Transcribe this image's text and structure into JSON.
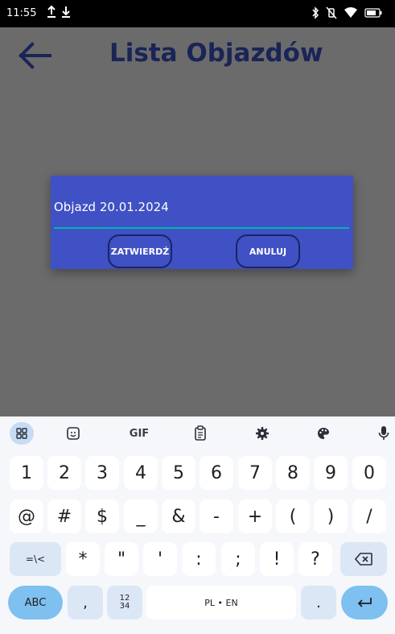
{
  "status_bar": {
    "time": "11:55",
    "left_icons": [
      "upload-icon",
      "download-icon"
    ],
    "right_icons": [
      "bluetooth-icon",
      "vibrate-off-icon",
      "wifi-icon",
      "battery-icon"
    ]
  },
  "app_bar": {
    "title": "Lista Objazdów",
    "back_icon": "arrow-left-icon",
    "title_color": "#1a2457"
  },
  "dialog": {
    "input_value": "Objazd 20.01.2024",
    "confirm_label": "ZATWIERDŹ",
    "cancel_label": "ANULUJ",
    "background_color": "#3f51c4",
    "underline_color": "#00b5b0"
  },
  "keyboard": {
    "toolbar": [
      "apps-grid-icon",
      "sticker-icon",
      "GIF",
      "clipboard-icon",
      "settings-icon",
      "palette-icon",
      "microphone-icon"
    ],
    "row1": [
      "1",
      "2",
      "3",
      "4",
      "5",
      "6",
      "7",
      "8",
      "9",
      "0"
    ],
    "row2": [
      "@",
      "#",
      "$",
      "_",
      "&",
      "-",
      "+",
      "(",
      ")",
      "/"
    ],
    "row3": {
      "more_symbols": "=\\<",
      "keys": [
        "*",
        "\"",
        "'",
        ":",
        ";",
        "!",
        "?"
      ],
      "backspace_icon": "backspace-icon"
    },
    "row4": {
      "abc": "ABC",
      "comma": ",",
      "numpad_top": "12",
      "numpad_bottom": "34",
      "space": "PL • EN",
      "period": ".",
      "enter_icon": "enter-icon"
    }
  }
}
